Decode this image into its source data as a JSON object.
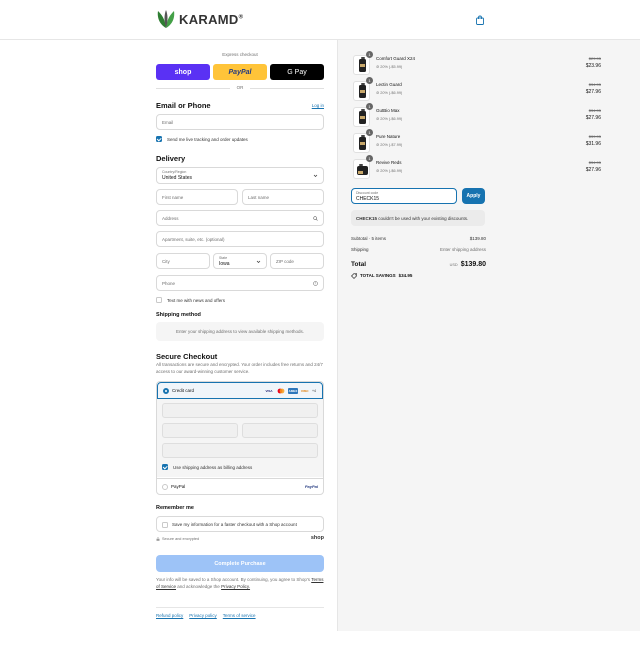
{
  "header": {
    "logo_text": "KARAMD",
    "logo_mark": "®"
  },
  "express": {
    "label": "Express checkout",
    "shop_label": "shop",
    "paypal_label": "PayPal",
    "gpay_label": "G Pay",
    "or_label": "OR"
  },
  "contact": {
    "title": "Email or Phone",
    "login_label": "Log in",
    "email_placeholder": "Email",
    "tracking_label": "Send me live tracking and order updates"
  },
  "delivery": {
    "title": "Delivery",
    "country_label": "Country/Region",
    "country_value": "United States",
    "first_name_placeholder": "First name",
    "last_name_placeholder": "Last name",
    "address_placeholder": "Address",
    "apartment_placeholder": "Apartment, suite, etc. (optional)",
    "city_placeholder": "City",
    "state_label": "State",
    "state_value": "Iowa",
    "zip_placeholder": "ZIP code",
    "phone_placeholder": "Phone",
    "news_label": "Text me with news and offers"
  },
  "shipping": {
    "title": "Shipping method",
    "info": "Enter your shipping address to view available shipping methods."
  },
  "payment": {
    "title": "Secure Checkout",
    "description": "All transactions are secure and encrypted. Your order includes free returns and 24/7 access to our award-winning customer service.",
    "credit_card_label": "Credit card",
    "cards": [
      "VISA",
      "MC",
      "AMEX",
      "DISC"
    ],
    "more_cards": "+4",
    "billing_label": "Use shipping address as billing address",
    "paypal_label": "PayPal",
    "paypal_logo": "PayPal"
  },
  "remember": {
    "title": "Remember me",
    "save_label": "Save my information for a faster checkout with a Shop account",
    "secure_label": "Secure and encrypted",
    "shop_logo": "shop"
  },
  "complete_button": "Complete Purchase",
  "legal": {
    "line1": "Your info will be saved to a Shop account. By continuing, you agree to Shop's",
    "terms": "Terms of Service",
    "and": "and acknowledge the",
    "privacy": "Privacy Policy."
  },
  "footer": {
    "links": [
      "Refund policy",
      "Privacy policy",
      "Terms of service"
    ]
  },
  "order": {
    "items": [
      {
        "qty": "1",
        "name": "Comfort Guard X24",
        "discount": "20% (-$5.99)",
        "old_price": "$29.95",
        "price": "$23.96"
      },
      {
        "qty": "1",
        "name": "Lectin Guard",
        "discount": "20% (-$6.99)",
        "old_price": "$34.95",
        "price": "$27.96"
      },
      {
        "qty": "1",
        "name": "GutBio Max",
        "discount": "20% (-$6.99)",
        "old_price": "$34.95",
        "price": "$27.96"
      },
      {
        "qty": "1",
        "name": "Pure Nature",
        "discount": "20% (-$7.99)",
        "old_price": "$39.95",
        "price": "$31.96"
      },
      {
        "qty": "1",
        "name": "Revive Reds",
        "discount": "20% (-$6.99)",
        "old_price": "$34.95",
        "price": "$27.96"
      }
    ],
    "discount_label": "Discount code",
    "discount_value": "CHECK15",
    "apply_label": "Apply",
    "error_code": "CHECK15",
    "error_text": "couldn't be used with your existing discounts.",
    "subtotal_label": "Subtotal · 5 items",
    "subtotal_value": "$139.80",
    "shipping_label": "Shipping",
    "shipping_value": "Enter shipping address",
    "total_label": "Total",
    "currency": "USD",
    "total_value": "$139.80",
    "savings_label": "TOTAL SAVINGS",
    "savings_value": "$34.95"
  }
}
